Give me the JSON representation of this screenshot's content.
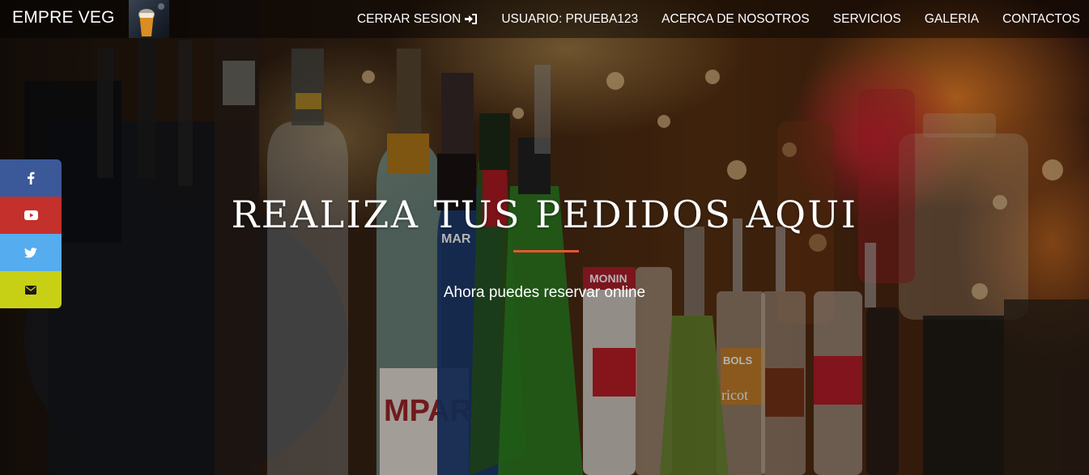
{
  "navbar": {
    "brand": "EMPRE VEG",
    "items": [
      {
        "label": "CERRAR SESION",
        "icon": "sign-in-icon"
      },
      {
        "label": "USUARIO: PRUEBA123"
      },
      {
        "label": "ACERCA DE NOSOTROS"
      },
      {
        "label": "SERVICIOS"
      },
      {
        "label": "GALERIA"
      },
      {
        "label": "CONTACTOS"
      }
    ]
  },
  "social": [
    {
      "name": "facebook",
      "icon": "facebook-icon",
      "color": "#3b5998"
    },
    {
      "name": "youtube",
      "icon": "youtube-icon",
      "color": "#c4302b"
    },
    {
      "name": "twitter",
      "icon": "twitter-icon",
      "color": "#55acee"
    },
    {
      "name": "email",
      "icon": "envelope-icon",
      "color": "#c8d016"
    }
  ],
  "hero": {
    "title": "REALIZA TUS PEDIDOS AQUI",
    "subtitle": "Ahora puedes reservar online",
    "accent_color": "#e8542f"
  }
}
